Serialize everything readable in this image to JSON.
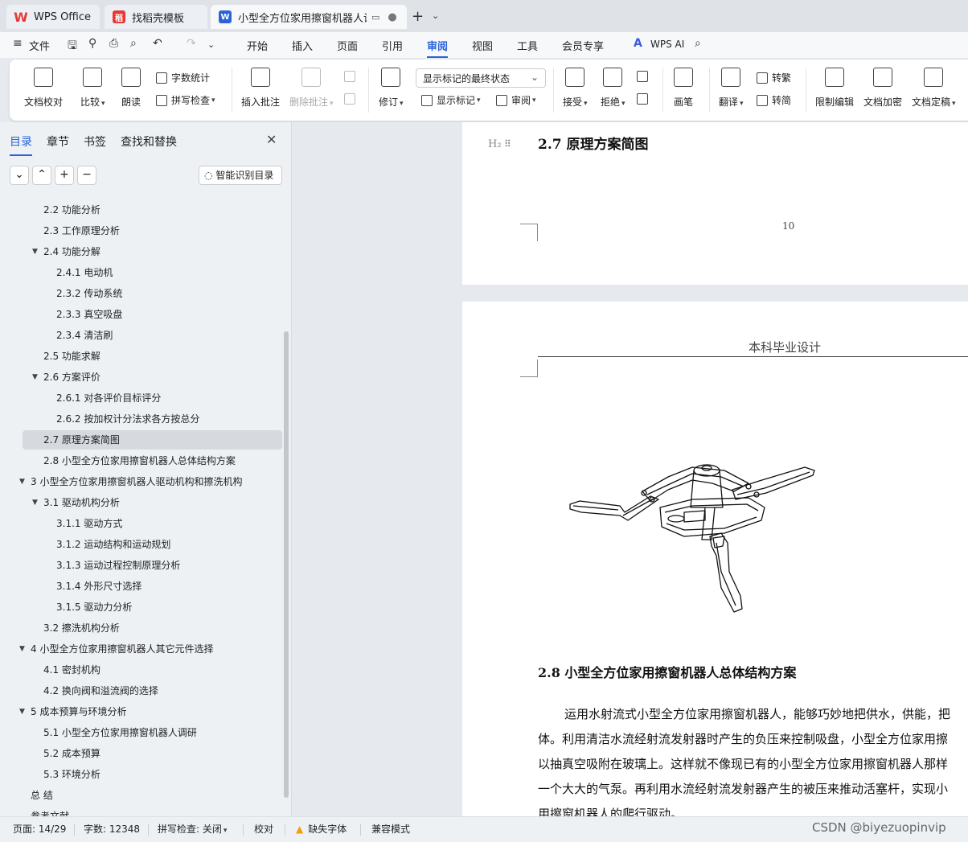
{
  "tabs": [
    {
      "label": "WPS Office"
    },
    {
      "label": "找稻壳模板"
    },
    {
      "label": "小型全方位家用擦窗机器人设计"
    }
  ],
  "menu": {
    "file": "文件",
    "items": [
      "开始",
      "插入",
      "页面",
      "引用",
      "审阅",
      "视图",
      "工具",
      "会员专享"
    ],
    "wps_ai": "WPS AI"
  },
  "ribbon": {
    "doc_check": "文档校对",
    "compare": "比较",
    "read_aloud": "朗读",
    "word_count": "字数统计",
    "spell_check": "拼写检查",
    "insert_comment": "插入批注",
    "delete_comment": "删除批注",
    "revise": "修订",
    "mark_state": "显示标记的最终状态",
    "show_marks": "显示标记",
    "review": "审阅",
    "accept": "接受",
    "reject": "拒绝",
    "pen": "画笔",
    "translate": "翻译",
    "to_traditional": "转繁",
    "to_simplified": "转简",
    "restrict_edit": "限制编辑",
    "encrypt": "文档加密",
    "finalize": "文档定稿"
  },
  "sidebar": {
    "tabs": [
      "目录",
      "章节",
      "书签",
      "查找和替换"
    ],
    "smart_button": "智能识别目录",
    "toc": [
      {
        "label": "2.2 功能分析",
        "level": 2,
        "expand": ""
      },
      {
        "label": "2.3 工作原理分析",
        "level": 2,
        "expand": ""
      },
      {
        "label": "2.4 功能分解",
        "level": 2,
        "expand": "open"
      },
      {
        "label": "2.4.1 电动机",
        "level": 3,
        "expand": ""
      },
      {
        "label": "2.3.2 传动系统",
        "level": 3,
        "expand": ""
      },
      {
        "label": "2.3.3 真空吸盘",
        "level": 3,
        "expand": ""
      },
      {
        "label": "2.3.4  清洁刷",
        "level": 3,
        "expand": ""
      },
      {
        "label": "2.5 功能求解",
        "level": 2,
        "expand": ""
      },
      {
        "label": "2.6 方案评价",
        "level": 2,
        "expand": "open"
      },
      {
        "label": "2.6.1 对各评价目标评分",
        "level": 3,
        "expand": ""
      },
      {
        "label": "2.6.2 按加权计分法求各方按总分",
        "level": 3,
        "expand": ""
      },
      {
        "label": "2.7 原理方案简图",
        "level": 2,
        "expand": "",
        "selected": true
      },
      {
        "label": "2.8  小型全方位家用擦窗机器人总体结构方案",
        "level": 2,
        "expand": ""
      },
      {
        "label": "3  小型全方位家用擦窗机器人驱动机构和擦洗机构",
        "level": 1,
        "expand": "open"
      },
      {
        "label": "3.1  驱动机构分析",
        "level": 2,
        "expand": "open"
      },
      {
        "label": "3.1.1  驱动方式",
        "level": 3,
        "expand": ""
      },
      {
        "label": "3.1.2 运动结构和运动规划",
        "level": 3,
        "expand": ""
      },
      {
        "label": "3.1.3 运动过程控制原理分析",
        "level": 3,
        "expand": ""
      },
      {
        "label": "3.1.4 外形尺寸选择",
        "level": 3,
        "expand": ""
      },
      {
        "label": "3.1.5 驱动力分析",
        "level": 3,
        "expand": ""
      },
      {
        "label": "3.2 擦洗机构分析",
        "level": 2,
        "expand": ""
      },
      {
        "label": "4  小型全方位家用擦窗机器人其它元件选择",
        "level": 1,
        "expand": "open"
      },
      {
        "label": "4.1 密封机构",
        "level": 2,
        "expand": ""
      },
      {
        "label": "4.2 换向阀和溢流阀的选择",
        "level": 2,
        "expand": ""
      },
      {
        "label": "5  成本预算与环境分析",
        "level": 1,
        "expand": "open"
      },
      {
        "label": "5.1  小型全方位家用擦窗机器人调研",
        "level": 2,
        "expand": ""
      },
      {
        "label": "5.2  成本预算",
        "level": 2,
        "expand": ""
      },
      {
        "label": "5.3  环境分析",
        "level": 2,
        "expand": ""
      },
      {
        "label": "总   结",
        "level": 1,
        "expand": ""
      },
      {
        "label": "参考文献",
        "level": 1,
        "expand": ""
      }
    ]
  },
  "document": {
    "page1": {
      "heading_marker": "H₂",
      "heading": "2.7 原理方案简图",
      "page_number": "10"
    },
    "page2": {
      "header": "本科毕业设计",
      "heading": "2.8  小型全方位家用擦窗机器人总体结构方案",
      "paragraph_lines": [
        "运用水射流式小型全方位家用擦窗机器人，能够巧妙地把供水，供能，把",
        "体。利用清洁水流经射流发射器时产生的负压来控制吸盘，小型全方位家用擦",
        "以抽真空吸附在玻璃上。这样就不像现已有的小型全方位家用擦窗机器人那样",
        "一个大大的气泵。再利用水流经射流发射器产生的被压来推动活塞杆，实现小",
        "用擦窗机器人的爬行驱动。"
      ]
    }
  },
  "statusbar": {
    "page": "页面: 14/29",
    "words": "字数: 12348",
    "spell": "拼写检查: 关闭",
    "proof": "校对",
    "missing_font": "缺失字体",
    "compat": "兼容模式",
    "watermark": "CSDN @biyezuopinvip"
  },
  "colors": {
    "accent": "#2a63d8",
    "wps_red": "#e53935"
  }
}
